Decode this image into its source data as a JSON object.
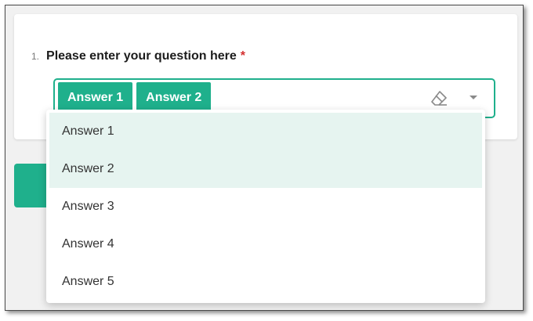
{
  "question": {
    "number": "1.",
    "text": "Please enter your question here",
    "required_marker": "*"
  },
  "select": {
    "selected_chips": [
      {
        "label": "Answer 1"
      },
      {
        "label": "Answer 2"
      }
    ],
    "icons": {
      "clear": "eraser-icon",
      "toggle": "caret-down-icon"
    }
  },
  "dropdown": {
    "options": [
      {
        "label": "Answer 1",
        "selected": true
      },
      {
        "label": "Answer 2",
        "selected": true
      },
      {
        "label": "Answer 3",
        "selected": false
      },
      {
        "label": "Answer 4",
        "selected": false
      },
      {
        "label": "Answer 5",
        "selected": false
      }
    ]
  },
  "colors": {
    "accent": "#1fb08c",
    "selected_option_bg": "#e6f4f0",
    "required": "#d32f2f"
  }
}
